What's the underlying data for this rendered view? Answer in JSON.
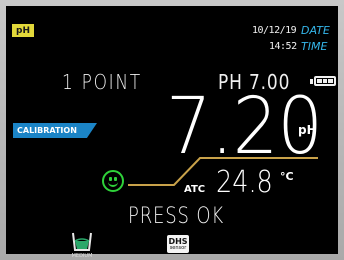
{
  "mode_badge": "pH",
  "header": {
    "date_value": "10/12/19",
    "date_label": "DATE",
    "time_value": "14:52",
    "time_label": "TIME"
  },
  "calibration": {
    "points_text": "1 POINT",
    "buffer_text": "PH 7.00",
    "badge_label": "CALIBRATION"
  },
  "reading": {
    "value": "7.20",
    "unit": "pH"
  },
  "temperature": {
    "atc_label": "ATC",
    "value": "24.8",
    "unit": "°C"
  },
  "status": {
    "text": "PRESS OK"
  },
  "footer": {
    "medium_label": "MEDIUM",
    "dhs_label": "DHS",
    "dhs_sub": "sensor"
  },
  "battery_level": 1.0,
  "colors": {
    "accent_blue": "#35b6ea",
    "badge_yellow": "#e2d83a",
    "smiley_green": "#2fd23a",
    "slope_gold": "#c9a24a",
    "medium_green": "#2aa86a"
  },
  "icons": [
    "smiley-face-icon",
    "battery-icon",
    "medium-beaker-icon",
    "dhs-sensor-icon"
  ]
}
